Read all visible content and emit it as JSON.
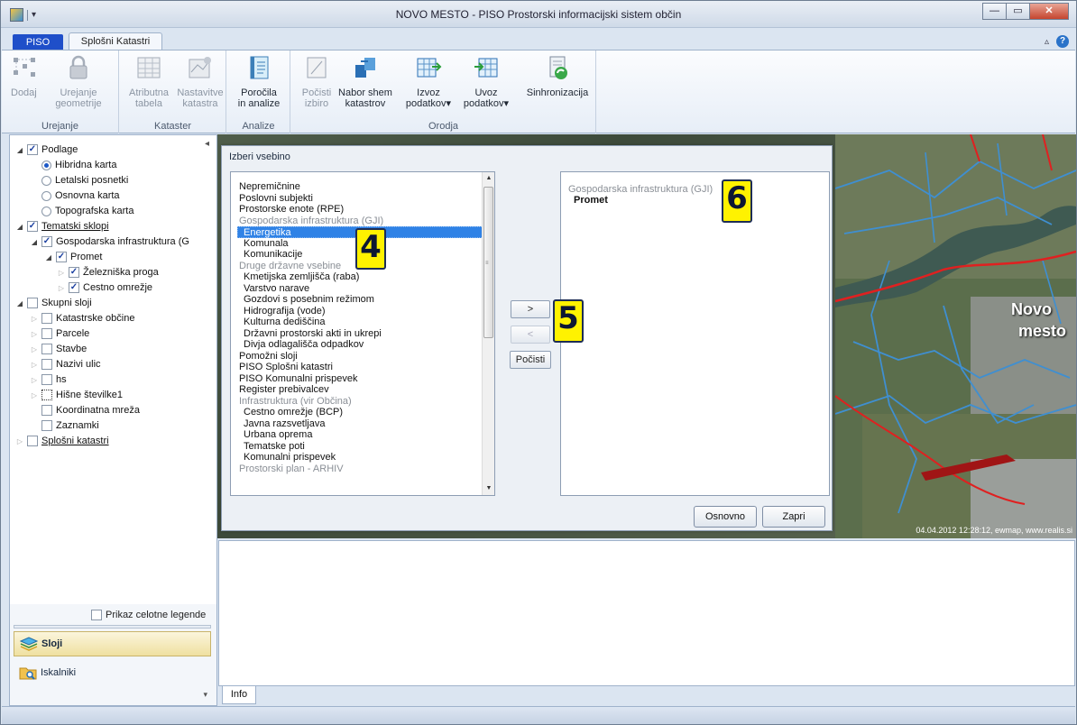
{
  "window": {
    "title": "NOVO MESTO - PISO Prostorski informacijski sistem občin"
  },
  "tabs": {
    "file": "PISO",
    "active": "Splošni Katastri"
  },
  "ribbon": {
    "groups": [
      {
        "label": "Urejanje",
        "buttons": [
          {
            "line1": "Dodaj",
            "line2": ""
          },
          {
            "line1": "Urejanje",
            "line2": "geometrije"
          }
        ]
      },
      {
        "label": "Kataster",
        "buttons": [
          {
            "line1": "Atributna",
            "line2": "tabela"
          },
          {
            "line1": "Nastavitve",
            "line2": "katastra"
          }
        ]
      },
      {
        "label": "Analize",
        "buttons": [
          {
            "line1": "Poročila",
            "line2": "in analize"
          }
        ]
      },
      {
        "label": "Orodja",
        "buttons": [
          {
            "line1": "Počisti",
            "line2": "izbiro"
          },
          {
            "line1": "Nabor shem",
            "line2": "katastrov"
          },
          {
            "line1": "Izvoz",
            "line2": "podatkov▾"
          },
          {
            "line1": "Uvoz",
            "line2": "podatkov▾"
          },
          {
            "line1": "Sinhronizacija",
            "line2": ""
          }
        ]
      }
    ]
  },
  "tree": [
    {
      "label": "Podlage",
      "level": 0,
      "exp": "◢",
      "kind": "cb",
      "checked": true
    },
    {
      "label": "Hibridna karta",
      "level": 1,
      "kind": "rb",
      "checked": true
    },
    {
      "label": "Letalski posnetki",
      "level": 1,
      "kind": "rb",
      "checked": false
    },
    {
      "label": "Osnovna karta",
      "level": 1,
      "kind": "rb",
      "checked": false
    },
    {
      "label": "Topografska karta",
      "level": 1,
      "kind": "rb",
      "checked": false
    },
    {
      "label": "Tematski sklopi",
      "level": 0,
      "exp": "◢",
      "kind": "cb",
      "checked": true,
      "underline": true
    },
    {
      "label": "Gospodarska infrastruktura (G",
      "level": 1,
      "exp": "◢",
      "kind": "cb",
      "checked": true
    },
    {
      "label": "Promet",
      "level": 2,
      "exp": "◢",
      "kind": "cb",
      "checked": true
    },
    {
      "label": "Železniška proga",
      "level": 3,
      "exp": "▷",
      "kind": "cb",
      "checked": true
    },
    {
      "label": "Cestno omrežje",
      "level": 3,
      "exp": "▷",
      "kind": "cb",
      "checked": true
    },
    {
      "label": "Skupni sloji",
      "level": 0,
      "exp": "◢",
      "kind": "cb",
      "checked": false
    },
    {
      "label": "Katastrske občine",
      "level": 1,
      "exp": "▷",
      "kind": "cb",
      "checked": false
    },
    {
      "label": "Parcele",
      "level": 1,
      "exp": "▷",
      "kind": "cb",
      "checked": false
    },
    {
      "label": "Stavbe",
      "level": 1,
      "exp": "▷",
      "kind": "cb",
      "checked": false
    },
    {
      "label": "Nazivi ulic",
      "level": 1,
      "exp": "▷",
      "kind": "cb",
      "checked": false
    },
    {
      "label": "hs",
      "level": 1,
      "exp": "▷",
      "kind": "cb",
      "checked": false
    },
    {
      "label": "Hišne številke1",
      "level": 1,
      "exp": "▷",
      "kind": "cb",
      "checked": false,
      "dotted": true
    },
    {
      "label": "Koordinatna mreža",
      "level": 1,
      "kind": "cb",
      "checked": false
    },
    {
      "label": "Zaznamki",
      "level": 1,
      "kind": "cb",
      "checked": false
    },
    {
      "label": "Splošni katastri",
      "level": 0,
      "exp": "▷",
      "kind": "cb",
      "checked": false,
      "underline": true
    }
  ],
  "left_panel": {
    "legend_label": "Prikaz celotne legende",
    "nav": [
      {
        "label": "Sloji",
        "icon": "layers-icon",
        "selected": true
      },
      {
        "label": "Iskalniki",
        "icon": "search-folder-icon",
        "selected": false
      }
    ]
  },
  "dialog": {
    "title": "Izberi vsebino",
    "left_list": [
      {
        "text": "Nepremičnine",
        "kind": "item"
      },
      {
        "text": "Poslovni subjekti",
        "kind": "item"
      },
      {
        "text": "Prostorske enote (RPE)",
        "kind": "item"
      },
      {
        "text": "Gospodarska infrastruktura (GJI)",
        "kind": "hdr"
      },
      {
        "text": "Energetika",
        "kind": "sel"
      },
      {
        "text": "Komunala",
        "kind": "sub"
      },
      {
        "text": "Komunikacije",
        "kind": "sub"
      },
      {
        "text": "Druge državne vsebine",
        "kind": "hdr"
      },
      {
        "text": "Kmetijska zemljišča (raba)",
        "kind": "sub"
      },
      {
        "text": "Varstvo narave",
        "kind": "sub"
      },
      {
        "text": "Gozdovi s posebnim režimom",
        "kind": "sub"
      },
      {
        "text": "Hidrografija (vode)",
        "kind": "sub"
      },
      {
        "text": "Kulturna dediščina",
        "kind": "sub"
      },
      {
        "text": "Državni prostorski akti in ukrepi",
        "kind": "sub"
      },
      {
        "text": "Divja odlagališča odpadkov",
        "kind": "sub"
      },
      {
        "text": "Pomožni sloji",
        "kind": "item"
      },
      {
        "text": "PISO Splošni katastri",
        "kind": "item"
      },
      {
        "text": "PISO Komunalni prispevek",
        "kind": "item"
      },
      {
        "text": "Register prebivalcev",
        "kind": "item"
      },
      {
        "text": "Infrastruktura (vir Občina)",
        "kind": "hdr"
      },
      {
        "text": "Cestno omrežje (BCP)",
        "kind": "sub"
      },
      {
        "text": "Javna razsvetljava",
        "kind": "sub"
      },
      {
        "text": "Urbana oprema",
        "kind": "sub"
      },
      {
        "text": "Tematske poti",
        "kind": "sub"
      },
      {
        "text": "Komunalni prispevek",
        "kind": "sub"
      },
      {
        "text": "Prostorski plan - ARHIV",
        "kind": "hdr"
      }
    ],
    "add_label": ">",
    "remove_label": "<",
    "clear_label": "Počisti",
    "right_group": "Gospodarska infrastruktura (GJI)",
    "right_item": "Promet",
    "basic_label": "Osnovno",
    "close_label": "Zapri"
  },
  "badges": {
    "b4": "4",
    "b5": "5",
    "b6": "6"
  },
  "map": {
    "stamp": "04.04.2012 12:28:12, ewmap, www.realis.si",
    "city_label_1": "Novo",
    "city_label_2": "mesto"
  },
  "info": {
    "tab": "Info"
  },
  "colors": {
    "accent": "#1f4fc9",
    "selection": "#2f82e6",
    "badge": "#fff200"
  }
}
